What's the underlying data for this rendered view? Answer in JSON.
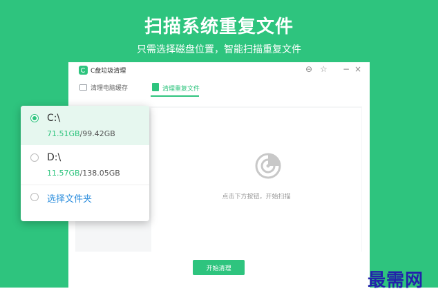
{
  "banner": {
    "headline": "扫描系统重复文件",
    "subline": "只需选择磁盘位置，智能扫描重复文件",
    "background_color": "#2ec47e"
  },
  "window": {
    "app_title": "C盘垃圾清理",
    "controls": {
      "settings": "⊖",
      "pin": "☆",
      "minimize": "−",
      "close": "×"
    }
  },
  "tabs": [
    {
      "label": "清理电脑缓存",
      "icon": "monitor-icon",
      "active": false
    },
    {
      "label": "清理重复文件",
      "icon": "document-icon",
      "active": true
    }
  ],
  "scan_panel": {
    "icon": "radar-scan-icon",
    "hint": "点击下方按钮，开始扫描"
  },
  "start_button_label": "开始清理",
  "drive_picker": {
    "items": [
      {
        "name": "C:\\",
        "used": "71.51GB",
        "separator": "/",
        "total": "99.42GB",
        "selected": true
      },
      {
        "name": "D:\\",
        "used": "11.57GB",
        "separator": "/",
        "total": "138.05GB",
        "selected": false
      }
    ],
    "folder_option": "选择文件夹"
  },
  "watermark": "最需网",
  "colors": {
    "accent": "#2ec47e",
    "link": "#2e8fde"
  }
}
